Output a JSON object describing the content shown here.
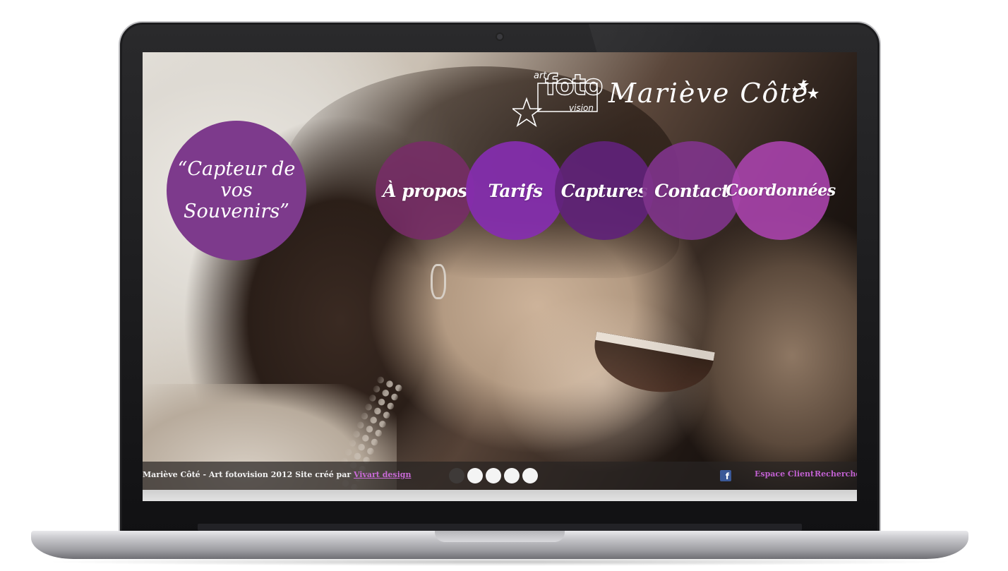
{
  "site": {
    "logo": {
      "art": "art",
      "foto": "foto",
      "vision": "vision",
      "name": "Mariève Côté"
    },
    "tagline": "“Capteur de vos Souvenirs”",
    "nav": [
      {
        "label": "À propos",
        "color": "#782c68"
      },
      {
        "label": "Tarifs",
        "color": "#862eb0"
      },
      {
        "label": "Captures",
        "color": "#602278"
      },
      {
        "label": "Contact",
        "color": "#80348c"
      },
      {
        "label": "Coordonnées",
        "color": "#a842ac"
      }
    ],
    "footer": {
      "credit": "Mariève Côté - Art fotovision 2012 Site créé par ",
      "credit_link": "Vivart design",
      "slider_dots": 5,
      "active_dot": 0,
      "facebook_icon": "facebook-icon",
      "links": [
        "Espace Client",
        "Rechercher"
      ]
    }
  },
  "colors": {
    "brand_purple": "#7d3a8c",
    "link_purple": "#c060d0",
    "footer_bg": "#282422"
  }
}
